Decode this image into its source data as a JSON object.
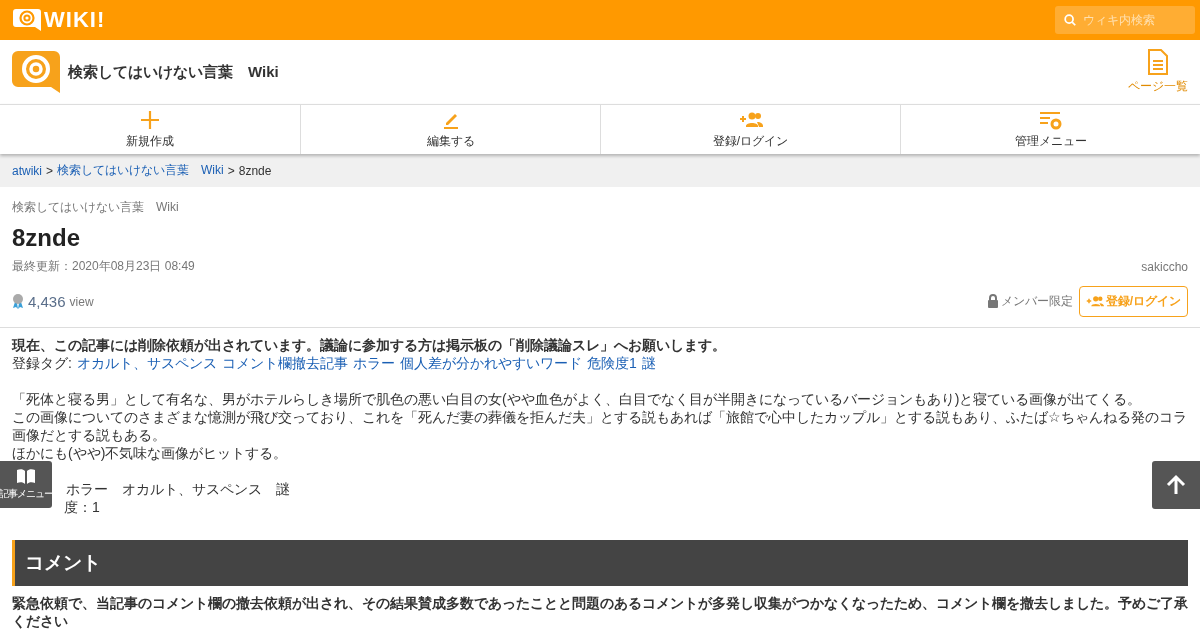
{
  "topbar": {
    "logo": "WIKI!",
    "search": {
      "placeholder": "ウィキ内検索"
    }
  },
  "header": {
    "title": "検索してはいけない言葉　Wiki",
    "page_list": "ページ一覧"
  },
  "nav": [
    {
      "kind": "plus",
      "label": "新規作成"
    },
    {
      "kind": "pen",
      "label": "編集する"
    },
    {
      "kind": "users",
      "label": "登録/ログイン"
    },
    {
      "kind": "gear",
      "label": "管理メニュー"
    }
  ],
  "breadcrumb": [
    {
      "label": "atwiki",
      "link": true
    },
    {
      "separator": ">",
      "label": "検索してはいけない言葉　Wiki",
      "link": true
    },
    {
      "separator": ">",
      "label": "8znde",
      "link": false
    }
  ],
  "page": {
    "wiki_name": "検索してはいけない言葉　Wiki",
    "title": "8znde",
    "updated": "最終更新：2020年08月23日 08:49",
    "author": "sakiccho",
    "views": "4,436",
    "views_unit": "view",
    "member_only": "メンバー限定",
    "login_button": "登録/ログイン"
  },
  "notice": "現在、この記事には削除依頼が出されています。議論に参加する方は掲示板の「削除議論スレ」へお願いします。",
  "tags": {
    "label": "登録タグ:",
    "items": [
      "オカルト、サスペンス",
      "コメント欄撤去記事",
      "ホラー",
      "個人差が分かれやすいワード",
      "危険度1",
      "謎"
    ]
  },
  "body": [
    "「死体と寝る男」として有名な、男がホテルらしき場所で肌色の悪い白目の女(やや血色がよく、白目でなく目が半開きになっているバージョンもあり)と寝ている画像が出てくる。",
    "この画像についてのさまざまな憶測が飛び交っており、これを「死んだ妻の葬儀を拒んだ夫」とする説もあれば「旅館で心中したカップル」とする説もあり、ふたば☆ちゃんねる発のコラ画像だとする説もある。",
    "ほかにも(やや)不気味な画像がヒットする。"
  ],
  "classification": "ホラー　オカルト、サスペンス　謎",
  "danger": "度：1",
  "article_menu": "記事メニュー",
  "comment": {
    "heading": "コメント",
    "text": "緊急依頼で、当記事のコメント欄の撤去依頼が出され、その結果賛成多数であったことと問題のあるコメントが多発し収集がつかなくなったため、コメント欄を撤去しました。予めご了承ください"
  }
}
